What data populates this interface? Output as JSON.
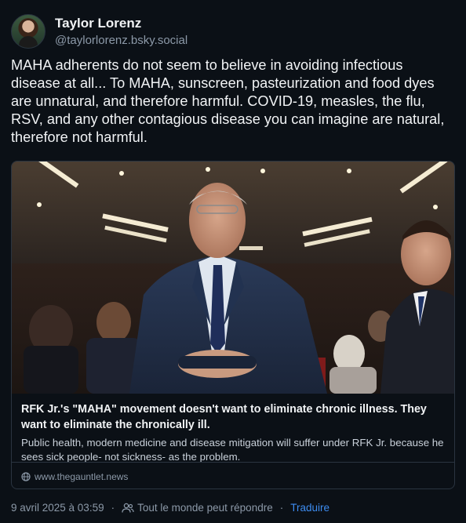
{
  "author": {
    "display_name": "Taylor Lorenz",
    "handle": "@taylorlorenz.bsky.social"
  },
  "post": {
    "text": "MAHA adherents do not seem to believe in avoiding infectious disease at all... To MAHA, sunscreen, pasteurization and food dyes are unnatural, and therefore harmful. COVID-19, measles, the flu, RSV, and any other contagious disease you can imagine are natural, therefore not harmful."
  },
  "link_card": {
    "title": "RFK Jr.'s \"MAHA\" movement doesn't want to eliminate chronic illness. They want to eliminate the chronically ill.",
    "description": "Public health, modern medicine and disease mitigation will suffer under RFK Jr. because he sees sick people- not sickness- as the problem.",
    "domain": "www.thegauntlet.news",
    "icon": "globe-icon"
  },
  "footer": {
    "timestamp": "9 avril 2025 à 03:59",
    "separator": "·",
    "reply_setting": "Tout le monde peut répondre",
    "reply_icon": "people-icon",
    "translate_label": "Traduire"
  },
  "colors": {
    "background": "#0b1016",
    "text": "#f1f3f5",
    "muted": "#8c99a8",
    "border": "#2a3440",
    "link": "#3d8cf0"
  }
}
